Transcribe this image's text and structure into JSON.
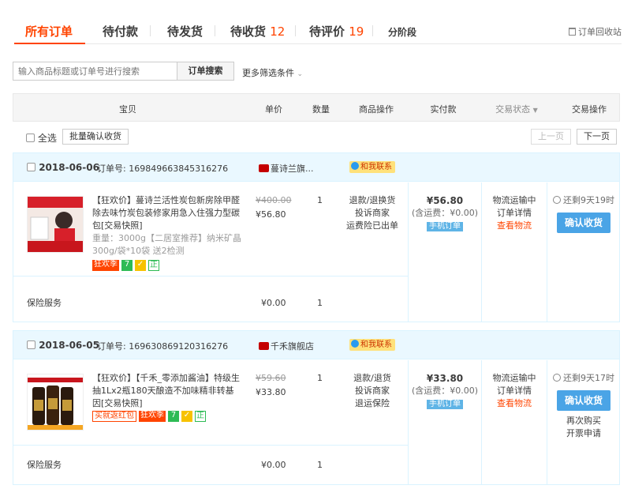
{
  "tabs": [
    {
      "label": "所有订单",
      "count": ""
    },
    {
      "label": "待付款",
      "count": ""
    },
    {
      "label": "待发货",
      "count": ""
    },
    {
      "label": "待收货",
      "count": "12"
    },
    {
      "label": "待评价",
      "count": "19"
    },
    {
      "label": "分阶段",
      "count": ""
    }
  ],
  "recycle_label": "订单回收站",
  "search": {
    "placeholder": "输入商品标题或订单号进行搜索",
    "button": "订单搜索",
    "more": "更多筛选条件"
  },
  "table_headers": [
    "宝贝",
    "单价",
    "数量",
    "商品操作",
    "实付款",
    "交易状态",
    "交易操作"
  ],
  "batch": {
    "select_all": "全选",
    "batch_confirm": "批量确认收货",
    "prev": "上一页",
    "next": "下一页"
  },
  "orders": [
    {
      "date": "2018-06-06",
      "order_no_label": "订单号: 169849663845316276",
      "shop": "蔓诗兰旗...",
      "contact": "和我联系",
      "item": {
        "title": "【狂欢价】蔓诗兰活性炭包新房除甲醛除去味竹炭包装修家用急入住强力型碳包[交易快照]",
        "spec": "重量：3000g【二居室推荐】纳米矿晶300g/袋*10袋 送2检测",
        "tags": [
          "狂欢季",
          "7",
          "✓",
          "正"
        ],
        "orig_price": "¥400.00",
        "price": "¥56.80",
        "qty": "1",
        "ops": [
          "退款/退换货",
          "投诉商家",
          "运费险已出单"
        ],
        "pay": "¥56.80",
        "pay_note": "(含运费：¥0.00)",
        "phone_tag": "手机订单",
        "status": [
          "物流运输中",
          "订单详情",
          "查看物流"
        ],
        "remaining": "还剩9天19时",
        "confirm": "确认收货",
        "extra_ops": []
      },
      "insurance": {
        "label": "保险服务",
        "price": "¥0.00",
        "qty": "1"
      }
    },
    {
      "date": "2018-06-05",
      "order_no_label": "订单号: 169630869120316276",
      "shop": "千禾旗舰店",
      "contact": "和我联系",
      "item": {
        "title": "【狂欢价】【千禾_零添加酱油】特级生抽1Lx2瓶180天酿造不加味精非转基因[交易快照]",
        "spec": "",
        "tags": [
          "买就返红包",
          "狂欢季",
          "7",
          "✓",
          "正"
        ],
        "orig_price": "¥59.60",
        "price": "¥33.80",
        "qty": "1",
        "ops": [
          "退款/退货",
          "投诉商家",
          "退运保险"
        ],
        "pay": "¥33.80",
        "pay_note": "(含运费：¥0.00)",
        "phone_tag": "手机订单",
        "status": [
          "物流运输中",
          "订单详情",
          "查看物流"
        ],
        "remaining": "还剩9天17时",
        "confirm": "确认收货",
        "extra_ops": [
          "再次购买",
          "开票申请"
        ]
      },
      "insurance": {
        "label": "保险服务",
        "price": "¥0.00",
        "qty": "1"
      }
    }
  ],
  "colors": {
    "accent": "#ff4400",
    "header_bg": "#eaf8ff",
    "confirm_btn": "#4aa4e6"
  }
}
